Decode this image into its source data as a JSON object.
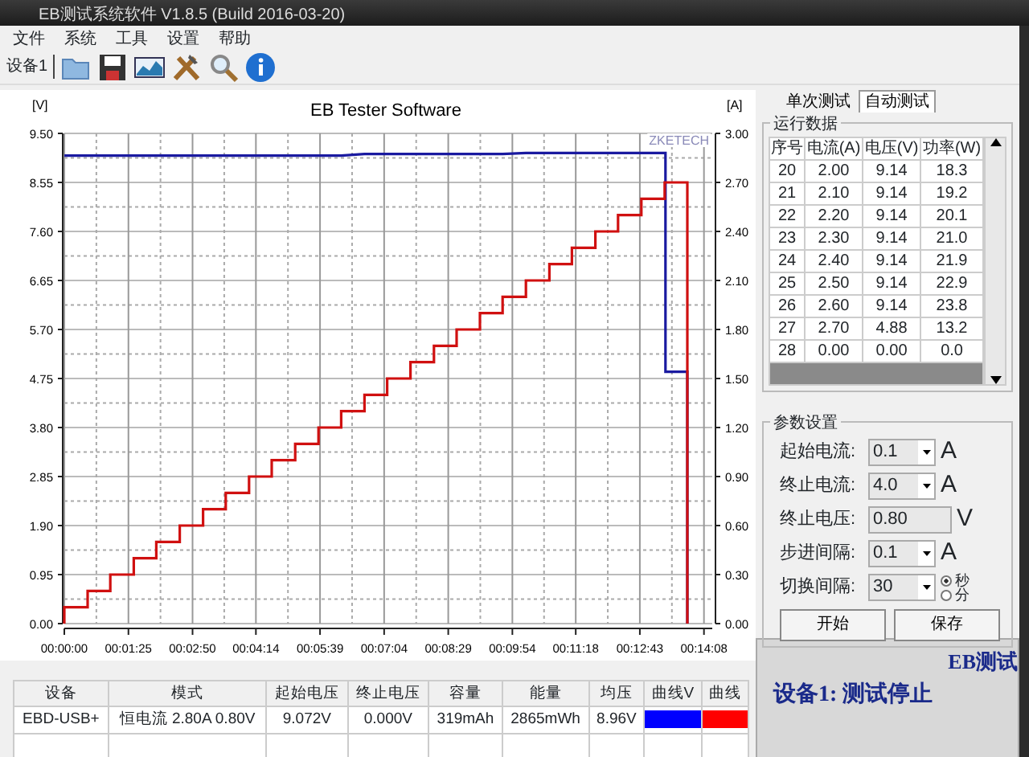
{
  "window": {
    "title": "EB测试系统软件 V1.8.5 (Build 2016-03-20)"
  },
  "menu": [
    "文件",
    "系统",
    "工具",
    "设置",
    "帮助"
  ],
  "toolbar": {
    "device": "设备1",
    "icons": [
      {
        "kind": "folder"
      },
      {
        "kind": "save"
      },
      {
        "kind": "chart"
      },
      {
        "kind": "tools"
      },
      {
        "kind": "search"
      },
      {
        "kind": "info"
      }
    ]
  },
  "chart": {
    "chart_data": {
      "type": "line",
      "title": "EB Tester Software",
      "grid": true,
      "ylabel": "[V]",
      "y2label": "[A]",
      "annotations": [
        "ZKETECH"
      ],
      "xlim": [
        0,
        859
      ],
      "ylim": [
        0,
        9.5
      ],
      "y2lim": [
        0,
        3
      ],
      "xticks": [
        {
          "value": 0,
          "label": "00:00:00"
        },
        {
          "value": 85,
          "label": "00:01:25"
        },
        {
          "value": 170,
          "label": "00:02:50"
        },
        {
          "value": 254,
          "label": "00:04:14"
        },
        {
          "value": 339,
          "label": "00:05:39"
        },
        {
          "value": 424,
          "label": "00:07:04"
        },
        {
          "value": 509,
          "label": "00:08:29"
        },
        {
          "value": 594,
          "label": "00:09:54"
        },
        {
          "value": 678,
          "label": "00:11:18"
        },
        {
          "value": 763,
          "label": "00:12:43"
        },
        {
          "value": 848,
          "label": "00:14:08"
        }
      ],
      "yticks": [
        {
          "value": 0,
          "label": "0.00"
        },
        {
          "value": 0.95,
          "label": "0.95"
        },
        {
          "value": 1.9,
          "label": "1.90"
        },
        {
          "value": 2.85,
          "label": "2.85"
        },
        {
          "value": 3.8,
          "label": "3.80"
        },
        {
          "value": 4.75,
          "label": "4.75"
        },
        {
          "value": 5.7,
          "label": "5.70"
        },
        {
          "value": 6.65,
          "label": "6.65"
        },
        {
          "value": 7.6,
          "label": "7.60"
        },
        {
          "value": 8.55,
          "label": "8.55"
        },
        {
          "value": 9.5,
          "label": "9.50"
        }
      ],
      "y2ticks": [
        {
          "value": 0,
          "label": "0.00"
        },
        {
          "value": 0.3,
          "label": "0.30"
        },
        {
          "value": 0.6,
          "label": "0.60"
        },
        {
          "value": 0.9,
          "label": "0.90"
        },
        {
          "value": 1.2,
          "label": "1.20"
        },
        {
          "value": 1.5,
          "label": "1.50"
        },
        {
          "value": 1.8,
          "label": "1.80"
        },
        {
          "value": 2.1,
          "label": "2.10"
        },
        {
          "value": 2.4,
          "label": "2.40"
        },
        {
          "value": 2.7,
          "label": "2.70"
        },
        {
          "value": 3,
          "label": "3.00"
        }
      ],
      "x": [
        0,
        0,
        31,
        31,
        61,
        61,
        92,
        92,
        122,
        122,
        153,
        153,
        184,
        184,
        214,
        214,
        245,
        245,
        275,
        275,
        306,
        306,
        337,
        337,
        367,
        367,
        398,
        398,
        428,
        428,
        459,
        459,
        490,
        490,
        520,
        520,
        551,
        551,
        581,
        581,
        612,
        612,
        643,
        643,
        673,
        673,
        704,
        704,
        734,
        734,
        765,
        765,
        796,
        796,
        797,
        797,
        826,
        826
      ],
      "series": [
        {
          "axis": "y",
          "color": "#1a1aa0",
          "values": [
            9.07,
            9.07,
            9.07,
            9.07,
            9.07,
            9.07,
            9.07,
            9.07,
            9.07,
            9.07,
            9.07,
            9.07,
            9.07,
            9.07,
            9.07,
            9.07,
            9.07,
            9.07,
            9.07,
            9.07,
            9.07,
            9.07,
            9.07,
            9.07,
            9.07,
            9.07,
            9.1,
            9.1,
            9.1,
            9.1,
            9.1,
            9.1,
            9.1,
            9.1,
            9.1,
            9.1,
            9.1,
            9.1,
            9.1,
            9.1,
            9.12,
            9.12,
            9.12,
            9.12,
            9.12,
            9.12,
            9.12,
            9.12,
            9.12,
            9.12,
            9.12,
            9.12,
            9.12,
            9.12,
            9.12,
            4.88,
            4.88,
            0
          ]
        },
        {
          "axis": "y2",
          "color": "#d01010",
          "values": [
            0,
            0.1,
            0.1,
            0.2,
            0.2,
            0.3,
            0.3,
            0.4,
            0.4,
            0.5,
            0.5,
            0.6,
            0.6,
            0.7,
            0.7,
            0.8,
            0.8,
            0.9,
            0.9,
            1.0,
            1.0,
            1.1,
            1.1,
            1.2,
            1.2,
            1.3,
            1.3,
            1.4,
            1.4,
            1.5,
            1.5,
            1.6,
            1.6,
            1.7,
            1.7,
            1.8,
            1.8,
            1.9,
            1.9,
            2.0,
            2.0,
            2.1,
            2.1,
            2.2,
            2.2,
            2.3,
            2.3,
            2.4,
            2.4,
            2.5,
            2.5,
            2.6,
            2.6,
            2.7,
            2.7,
            2.7,
            2.7,
            0
          ]
        }
      ]
    }
  },
  "tabs": [
    {
      "label": "单次测试",
      "selected": false
    },
    {
      "label": "自动测试",
      "selected": true
    }
  ],
  "run_data": {
    "title": "运行数据",
    "columns": [
      "序号",
      "电流(A)",
      "电压(V)",
      "功率(W)"
    ],
    "rows": [
      [
        "20",
        "2.00",
        "9.14",
        "18.3"
      ],
      [
        "21",
        "2.10",
        "9.14",
        "19.2"
      ],
      [
        "22",
        "2.20",
        "9.14",
        "20.1"
      ],
      [
        "23",
        "2.30",
        "9.14",
        "21.0"
      ],
      [
        "24",
        "2.40",
        "9.14",
        "21.9"
      ],
      [
        "25",
        "2.50",
        "9.14",
        "22.9"
      ],
      [
        "26",
        "2.60",
        "9.14",
        "23.8"
      ],
      [
        "27",
        "2.70",
        "4.88",
        "13.2"
      ],
      [
        "28",
        "0.00",
        "0.00",
        "0.0"
      ]
    ]
  },
  "params": {
    "title": "参数设置",
    "rows": [
      {
        "label": "起始电流:",
        "value": "0.1",
        "kind": "combo",
        "unit": "A"
      },
      {
        "label": "终止电流:",
        "value": "4.0",
        "kind": "combo",
        "unit": "A"
      },
      {
        "label": "终止电压:",
        "value": "0.80",
        "kind": "text",
        "unit": "V"
      },
      {
        "label": "步进间隔:",
        "value": "0.1",
        "kind": "combo",
        "unit": "A"
      },
      {
        "label": "切换间隔:",
        "value": "30",
        "kind": "combo",
        "radios": [
          {
            "label": "秒",
            "selected": true
          },
          {
            "label": "分",
            "selected": false
          }
        ]
      }
    ],
    "buttons": [
      "开始",
      "保存"
    ]
  },
  "results": {
    "columns": [
      "设备",
      "模式",
      "起始电压",
      "终止电压",
      "容量",
      "能量",
      "均压",
      "曲线V",
      "曲线"
    ],
    "rows": [
      {
        "cells": [
          "EBD-USB+",
          "恒电流  2.80A  0.80V",
          "9.072V",
          "0.000V",
          "319mAh",
          "2865mWh",
          "8.96V"
        ],
        "swatches": [
          {
            "color": "#0000ff"
          },
          {
            "color": "#ff0000"
          }
        ]
      }
    ]
  },
  "status": {
    "brand": "EB测试",
    "message": "设备1: 测试停止"
  }
}
